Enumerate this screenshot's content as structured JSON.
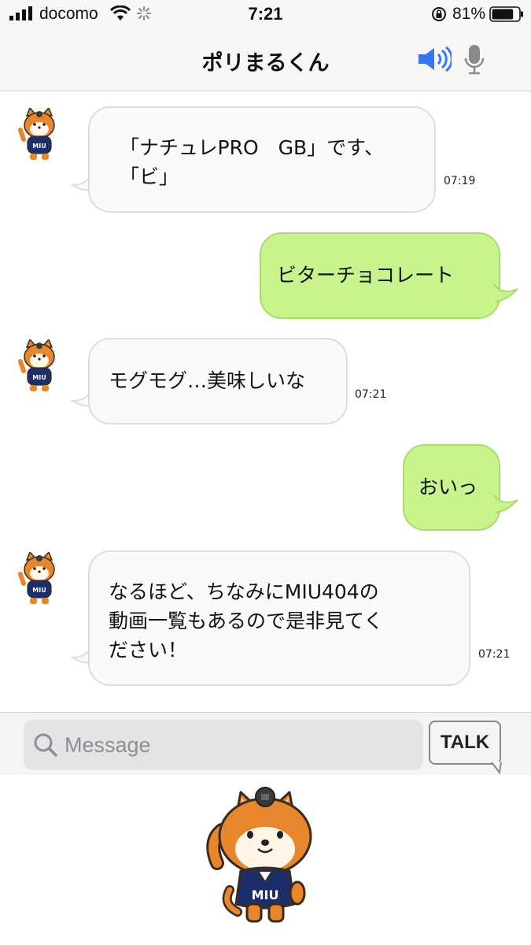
{
  "status_bar": {
    "carrier": "docomo",
    "time": "7:21",
    "battery_percent": "81%",
    "battery_level": 0.81
  },
  "header": {
    "title": "ポリまるくん"
  },
  "messages": [
    {
      "sender": "bot",
      "lines": [
        "「ナチュレPRO　GB」です、",
        "「ビ」"
      ],
      "time": "07:19"
    },
    {
      "sender": "user",
      "lines": [
        "ビターチョコレート"
      ]
    },
    {
      "sender": "bot",
      "lines": [
        "モグモグ…美味しいな"
      ],
      "time": "07:21"
    },
    {
      "sender": "user",
      "lines": [
        "おいっ"
      ]
    },
    {
      "sender": "bot",
      "lines": [
        "なるほど、ちなみにMIU404の",
        "動画一覧もあるので是非見てく",
        "ださい！"
      ],
      "time": "07:21"
    }
  ],
  "input": {
    "placeholder": "Message",
    "talk_label": "TALK"
  },
  "avatar_badge": "MIU",
  "colors": {
    "user_bubble": "#c8f48e",
    "bot_bubble": "#fafafa",
    "accent_blue": "#3478f6"
  }
}
